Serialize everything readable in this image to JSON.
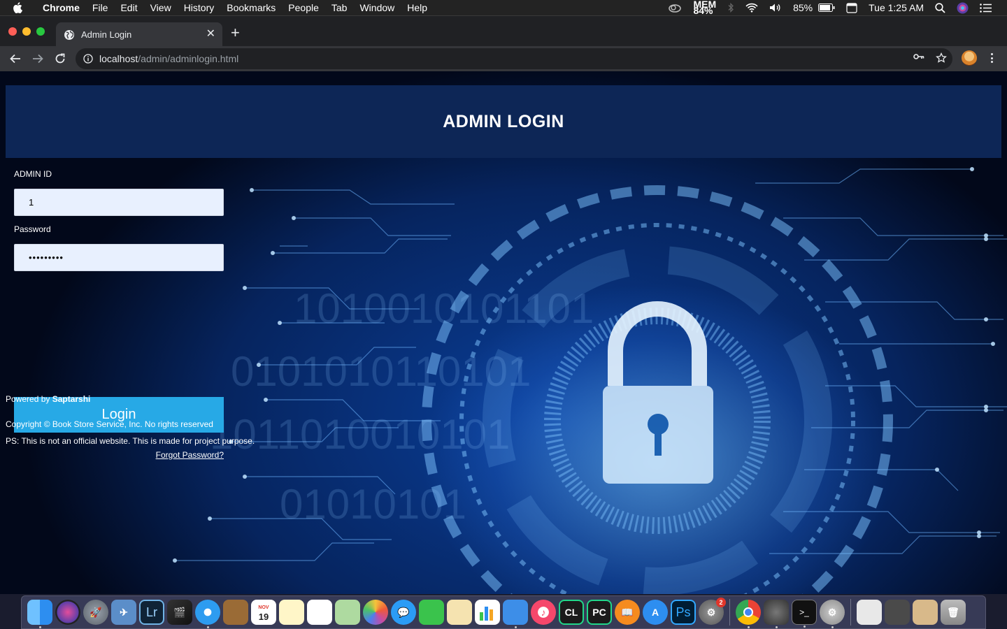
{
  "menubar": {
    "items": [
      "Chrome",
      "File",
      "Edit",
      "View",
      "History",
      "Bookmarks",
      "People",
      "Tab",
      "Window",
      "Help"
    ],
    "mem_label": "MEM",
    "mem_value": "84%",
    "battery": "85%",
    "clock": "Tue 1:25 AM"
  },
  "browser": {
    "tab_title": "Admin Login",
    "url_host": "localhost",
    "url_path": "/admin/adminlogin.html"
  },
  "page": {
    "heading": "ADMIN LOGIN",
    "admin_id_label": "ADMIN ID",
    "admin_id_value": "1",
    "password_label": "Password",
    "password_value": "•••••••••",
    "login_label": "Login",
    "forgot_label": "Forgot Password?",
    "powered_prefix": "Powered by ",
    "powered_name": "Saptarshi",
    "copyright": "Copyright © Book Store Service, Inc. No rights reserved",
    "disclaimer": "PS: This is not an official website. This is made for project purpose."
  },
  "dock": {
    "calendar_month": "NOV",
    "calendar_day": "19",
    "settings_badge": "2"
  }
}
